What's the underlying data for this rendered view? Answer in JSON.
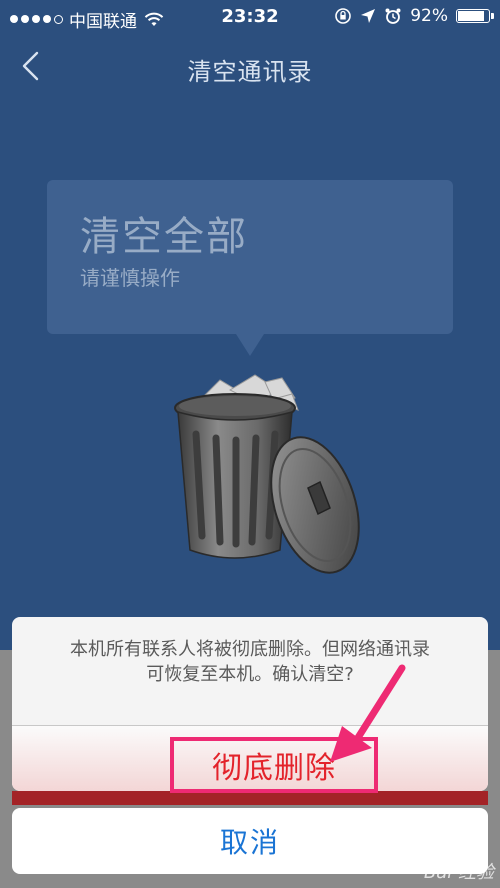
{
  "status_bar": {
    "carrier": "中国联通",
    "time": "23:32",
    "battery": "92%",
    "battery_level": 0.92
  },
  "nav": {
    "title": "清空通讯录"
  },
  "bubble": {
    "title": "清空全部",
    "subtitle": "请谨慎操作"
  },
  "action_sheet": {
    "message_line1": "本机所有联系人将被彻底删除。但网络通讯录",
    "message_line2": "可恢复至本机。确认清空?",
    "delete_label": "彻底删除",
    "cancel_label": "取消"
  },
  "colors": {
    "background": "#2c4f7e",
    "delete_text": "#e3232b",
    "highlight": "#ee2a73",
    "cancel_text": "#1a74d4"
  },
  "icons": {
    "back": "chevron-left-icon",
    "wifi": "wifi-icon",
    "lock_rotation": "rotation-lock-icon",
    "location": "location-arrow-icon",
    "alarm": "alarm-icon",
    "trash": "trash-can-icon"
  }
}
